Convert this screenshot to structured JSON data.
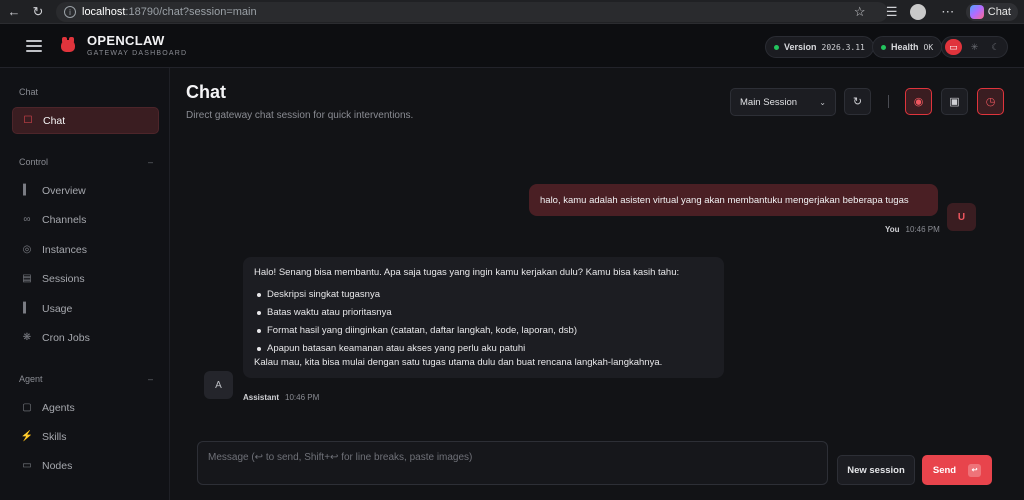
{
  "browser": {
    "url_host": "localhost",
    "url_path": ":18790/chat?session=main",
    "copilot_label": "Chat"
  },
  "brand": {
    "name": "OPENCLAW",
    "subtitle": "GATEWAY DASHBOARD"
  },
  "status": {
    "version_label": "Version",
    "version_value": "2026.3.11",
    "health_label": "Health",
    "health_value": "OK",
    "dot_color": "#23c55e"
  },
  "sidebar": {
    "sections": [
      {
        "label": "Chat",
        "items": [
          {
            "label": "Chat",
            "icon": "chat-icon",
            "active": true
          }
        ]
      },
      {
        "label": "Control",
        "items": [
          {
            "label": "Overview",
            "icon": "bar-chart-icon"
          },
          {
            "label": "Channels",
            "icon": "link-icon"
          },
          {
            "label": "Instances",
            "icon": "radio-icon"
          },
          {
            "label": "Sessions",
            "icon": "document-icon"
          },
          {
            "label": "Usage",
            "icon": "bar-chart-icon"
          },
          {
            "label": "Cron Jobs",
            "icon": "loader-icon"
          }
        ]
      },
      {
        "label": "Agent",
        "items": [
          {
            "label": "Agents",
            "icon": "folder-icon"
          },
          {
            "label": "Skills",
            "icon": "bolt-icon"
          },
          {
            "label": "Nodes",
            "icon": "monitor-icon"
          }
        ]
      }
    ]
  },
  "page": {
    "title": "Chat",
    "subtitle": "Direct gateway chat session for quick interventions.",
    "session_select": "Main Session"
  },
  "messages": {
    "user": {
      "text": "halo, kamu adalah asisten virtual yang akan membantuku mengerjakan beberapa tugas",
      "avatar": "U",
      "author": "You",
      "time": "10:46 PM"
    },
    "assistant": {
      "intro": "Halo! Senang bisa membantu. Apa saja tugas yang ingin kamu kerjakan dulu? Kamu bisa kasih tahu:",
      "bullets": [
        "Deskripsi singkat tugasnya",
        "Batas waktu atau prioritasnya",
        "Format hasil yang diinginkan (catatan, daftar langkah, kode, laporan, dsb)",
        "Apapun batasan keamanan atau akses yang perlu aku patuhi"
      ],
      "outro": "Kalau mau, kita bisa mulai dengan satu tugas utama dulu dan buat rencana langkah-langkahnya.",
      "avatar": "A",
      "author": "Assistant",
      "time": "10:46 PM"
    }
  },
  "composer": {
    "placeholder": "Message (↩ to send, Shift+↩ for line breaks, paste images)",
    "new_session": "New session",
    "send": "Send",
    "send_key": "↩"
  },
  "colors": {
    "accent": "#e8444c",
    "user_bubble": "#4a1f24",
    "assistant_bubble": "#1c1d22"
  }
}
